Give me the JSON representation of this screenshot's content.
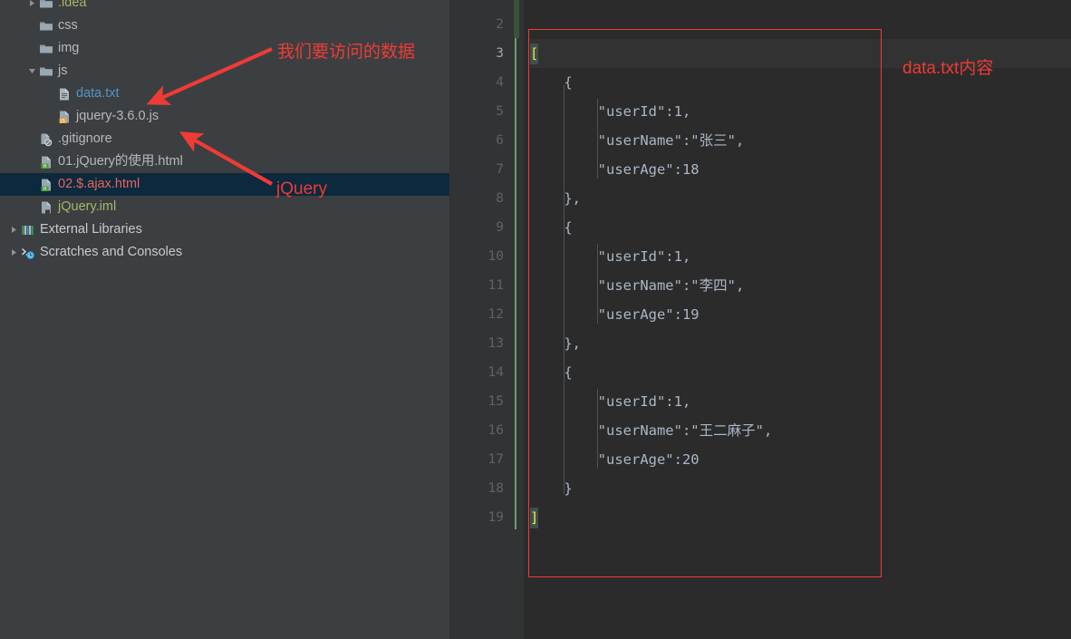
{
  "app": {
    "theme": "darcula",
    "accent_red": "#ef3b36",
    "sidebar_bg": "#3c3f41",
    "editor_bg": "#2b2b2b",
    "gutter_bg": "#313335",
    "selection_bg": "#0d293e"
  },
  "sidebar": {
    "name": "project-tree",
    "items": [
      {
        "label": ".idea",
        "icon": "folder-icon",
        "indent": 1,
        "twisty": "collapsed",
        "color": "c-olive",
        "selected": false
      },
      {
        "label": "css",
        "icon": "folder-icon",
        "indent": 1,
        "twisty": "none",
        "color": "c-grey",
        "selected": false
      },
      {
        "label": "img",
        "icon": "folder-icon",
        "indent": 1,
        "twisty": "none",
        "color": "c-grey",
        "selected": false
      },
      {
        "label": "js",
        "icon": "folder-icon",
        "indent": 1,
        "twisty": "expanded",
        "color": "c-grey",
        "selected": false
      },
      {
        "label": "data.txt",
        "icon": "text-file-icon",
        "indent": 2,
        "twisty": "none",
        "color": "c-blue",
        "selected": false
      },
      {
        "label": "jquery-3.6.0.js",
        "icon": "js-file-icon",
        "indent": 2,
        "twisty": "none",
        "color": "c-grey",
        "selected": false
      },
      {
        "label": ".gitignore",
        "icon": "gitignore-file-icon",
        "indent": 1,
        "twisty": "none",
        "color": "c-grey",
        "selected": false
      },
      {
        "label": "01.jQuery的使用.html",
        "icon": "html-file-icon",
        "indent": 1,
        "twisty": "none",
        "color": "c-grey",
        "selected": false
      },
      {
        "label": "02.$.ajax.html",
        "icon": "html-file-icon",
        "indent": 1,
        "twisty": "none",
        "color": "c-salmon",
        "selected": true
      },
      {
        "label": "jQuery.iml",
        "icon": "iml-file-icon",
        "indent": 1,
        "twisty": "none",
        "color": "c-olive",
        "selected": false
      },
      {
        "label": "External Libraries",
        "icon": "libraries-icon",
        "indent": 0,
        "twisty": "collapsed",
        "color": "c-white",
        "selected": false
      },
      {
        "label": "Scratches and Consoles",
        "icon": "scratches-icon",
        "indent": 0,
        "twisty": "collapsed",
        "color": "c-white",
        "selected": false
      }
    ]
  },
  "editor": {
    "name": "code-editor",
    "filename": "data.txt",
    "current_line": 3,
    "first_visible_line": 2,
    "line_numbers": [
      2,
      3,
      4,
      5,
      6,
      7,
      8,
      9,
      10,
      11,
      12,
      13,
      14,
      15,
      16,
      17,
      18,
      19
    ],
    "lines": [
      {
        "num": 2,
        "text": ""
      },
      {
        "num": 3,
        "text": "[",
        "brace": true
      },
      {
        "num": 4,
        "text": "    {"
      },
      {
        "num": 5,
        "text": "        \"userId\":1,"
      },
      {
        "num": 6,
        "text": "        \"userName\":\"张三\","
      },
      {
        "num": 7,
        "text": "        \"userAge\":18"
      },
      {
        "num": 8,
        "text": "    },"
      },
      {
        "num": 9,
        "text": "    {"
      },
      {
        "num": 10,
        "text": "        \"userId\":1,"
      },
      {
        "num": 11,
        "text": "        \"userName\":\"李四\","
      },
      {
        "num": 12,
        "text": "        \"userAge\":19"
      },
      {
        "num": 13,
        "text": "    },"
      },
      {
        "num": 14,
        "text": "    {"
      },
      {
        "num": 15,
        "text": "        \"userId\":1,"
      },
      {
        "num": 16,
        "text": "        \"userName\":\"王二麻子\","
      },
      {
        "num": 17,
        "text": "        \"userAge\":20"
      },
      {
        "num": 18,
        "text": "    }"
      },
      {
        "num": 19,
        "text": "]",
        "brace": true
      }
    ],
    "json_payload": [
      {
        "userId": 1,
        "userName": "张三",
        "userAge": 18
      },
      {
        "userId": 1,
        "userName": "李四",
        "userAge": 19
      },
      {
        "userId": 1,
        "userName": "王二麻子",
        "userAge": 20
      }
    ]
  },
  "annotations": {
    "data_note": "我们要访问的数据",
    "jquery_note": "jQuery",
    "content_note": "data.txt内容"
  }
}
